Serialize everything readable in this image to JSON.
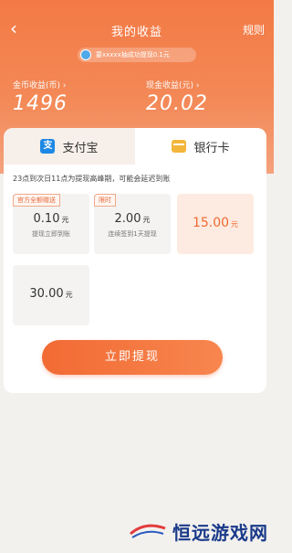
{
  "header": {
    "title": "我的收益",
    "rules_label": "规则",
    "back_glyph": "‹"
  },
  "ticker": {
    "text": "要xxxxx抽成功提现0.1元"
  },
  "stats": {
    "coins_label": "金币收益(币) ›",
    "coins_value": "1496",
    "cash_label": "现金收益(元) ›",
    "cash_value": "20.02"
  },
  "tabs": [
    {
      "label": "支付宝",
      "icon": "alipay-icon"
    },
    {
      "label": "银行卡",
      "icon": "bank-card-icon"
    }
  ],
  "notice": "23点到次日11点为提现高峰期，可能会延迟到账",
  "options": [
    {
      "tag": "官方全额赠送",
      "amount": "0.10",
      "unit": "元",
      "desc": "提现立即到账"
    },
    {
      "tag": "限时",
      "amount": "2.00",
      "unit": "元",
      "desc": "连续签到1天提现"
    },
    {
      "tag": "",
      "amount": "15.00",
      "unit": "元",
      "desc": ""
    },
    {
      "tag": "",
      "amount": "30.00",
      "unit": "元",
      "desc": ""
    }
  ],
  "withdraw_label": "立即提现",
  "watermark": "恒远游戏网",
  "colors": {
    "accent": "#f26a34",
    "hero": "#f37a45",
    "selected_bg": "#fdebe1"
  }
}
